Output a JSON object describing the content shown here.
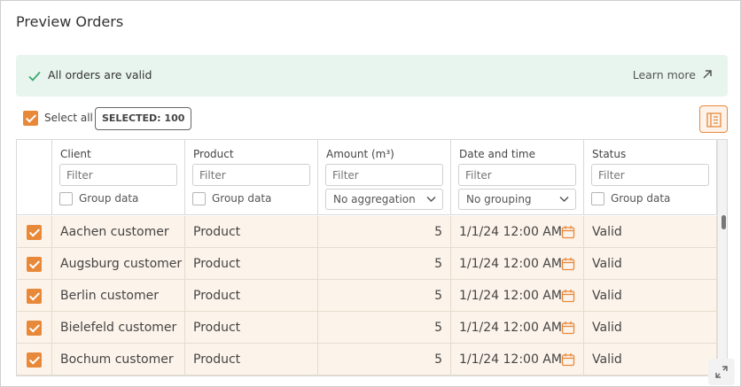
{
  "page": {
    "title": "Preview Orders"
  },
  "banner": {
    "message": "All orders are valid",
    "link": "Learn more",
    "icon": "check-icon",
    "color": "#e8f5ee"
  },
  "toolbar": {
    "select_all": "Select all",
    "selected_badge": "SELECTED: 100",
    "columns_icon": "columns-icon"
  },
  "columns": [
    {
      "label": "Client",
      "filter_placeholder": "Filter",
      "group_label": "Group data"
    },
    {
      "label": "Product",
      "filter_placeholder": "Filter",
      "group_label": "Group data"
    },
    {
      "label": "Amount (m³)",
      "filter_placeholder": "Filter",
      "aggregation": "No aggregation"
    },
    {
      "label": "Date and time",
      "filter_placeholder": "Filter",
      "grouping": "No grouping"
    },
    {
      "label": "Status",
      "filter_placeholder": "Filter",
      "group_label": "Group data"
    }
  ],
  "rows": [
    {
      "checked": true,
      "client": "Aachen customer",
      "product": "Product",
      "amount": "5",
      "date": "1/1/24 12:00 AM",
      "status": "Valid"
    },
    {
      "checked": true,
      "client": "Augsburg customer",
      "product": "Product",
      "amount": "5",
      "date": "1/1/24 12:00 AM",
      "status": "Valid"
    },
    {
      "checked": true,
      "client": "Berlin customer",
      "product": "Product",
      "amount": "5",
      "date": "1/1/24 12:00 AM",
      "status": "Valid"
    },
    {
      "checked": true,
      "client": "Bielefeld customer",
      "product": "Product",
      "amount": "5",
      "date": "1/1/24 12:00 AM",
      "status": "Valid"
    },
    {
      "checked": true,
      "client": "Bochum customer",
      "product": "Product",
      "amount": "5",
      "date": "1/1/24 12:00 AM",
      "status": "Valid"
    }
  ],
  "colors": {
    "accent": "#e8893a",
    "row_bg": "#fcf3ea",
    "success": "#3aa86b"
  }
}
